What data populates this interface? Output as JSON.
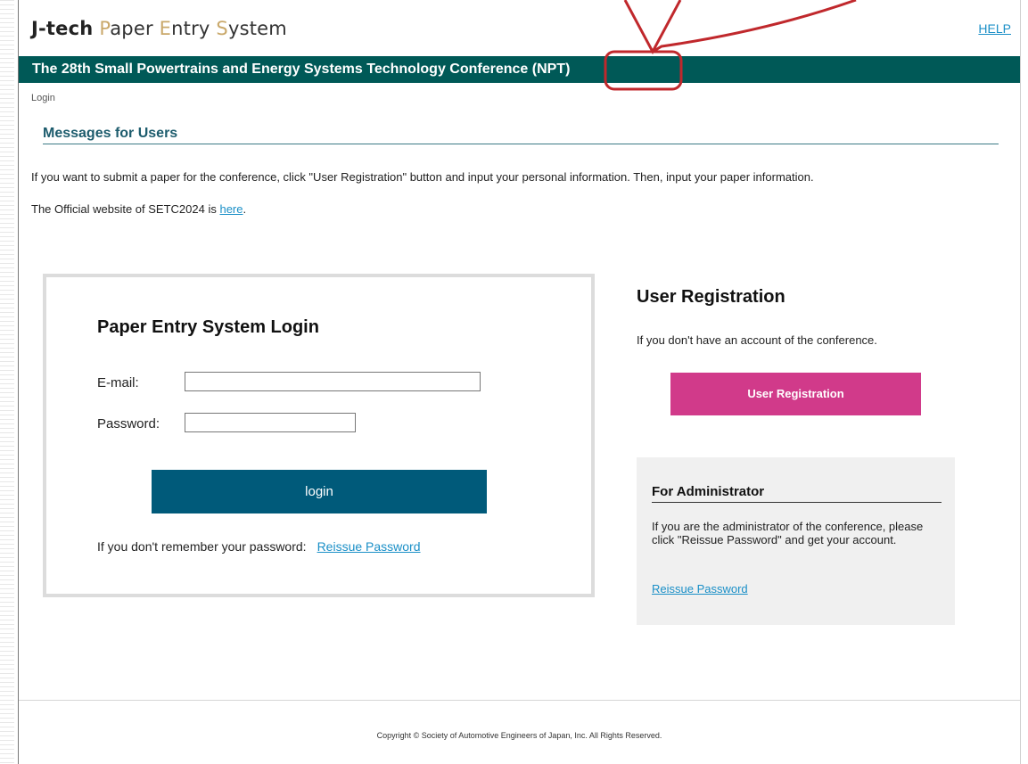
{
  "header": {
    "site_title_jt": "J-tech",
    "site_title_p": "P",
    "site_title_aper": "aper ",
    "site_title_e": "E",
    "site_title_ntry": "ntry ",
    "site_title_s": "S",
    "site_title_ystem": "ystem",
    "help_label": "HELP",
    "conference_title": "The 28th Small Powertrains and Energy Systems Technology Conference (NPT)"
  },
  "breadcrumb": "Login",
  "messages": {
    "heading": "Messages for Users",
    "line1": "If you want to submit a paper for the conference, click \"User Registration\" button and input your personal information. Then, input your paper information.",
    "line2_prefix": "The Official website of SETC2024 is ",
    "line2_link": "here",
    "line2_suffix": "."
  },
  "login": {
    "title": "Paper Entry System Login",
    "email_label": "E-mail:",
    "email_value": "",
    "password_label": "Password:",
    "password_value": "",
    "button_label": "login",
    "forgot_text": "If you don't remember your password:",
    "reissue_link": "Reissue Password"
  },
  "registration": {
    "title": "User Registration",
    "description": "If you don't have an account of the conference.",
    "button_label": "User Registration"
  },
  "admin": {
    "heading": "For Administrator",
    "text": "If you are the administrator of the conference, please click \"Reissue Password\" and get your account.",
    "link": "Reissue Password"
  },
  "footer": {
    "copyright": "Copyright © Society of Automotive Engineers of Japan, Inc. All Rights Reserved."
  },
  "colors": {
    "conference_bar": "#005957",
    "login_button": "#005a7a",
    "registration_button": "#d13a8a",
    "link": "#1a8fc7",
    "callout": "#c0282c"
  }
}
